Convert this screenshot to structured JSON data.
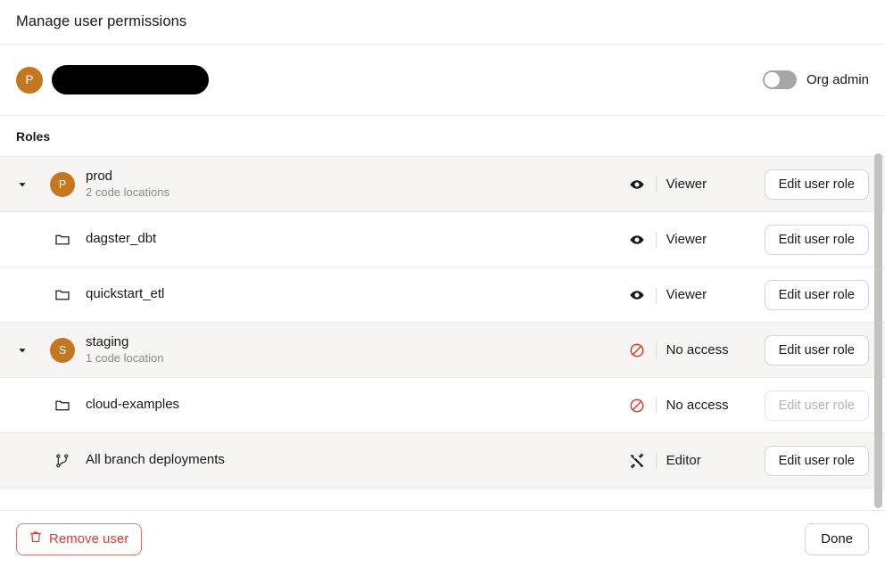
{
  "header": {
    "title": "Manage user permissions"
  },
  "user": {
    "avatar_initial": "P",
    "avatar_color": "#c3771f",
    "name_redacted": true,
    "org_admin_label": "Org admin",
    "org_admin_enabled": false
  },
  "roles_section": {
    "label": "Roles",
    "rows": [
      {
        "type": "deployment",
        "icon": "avatar-initial",
        "avatar_initial": "P",
        "expanded": true,
        "title": "prod",
        "subtitle": "2 code locations",
        "permission_icon": "eye-icon",
        "permission": "Viewer",
        "edit_label": "Edit user role",
        "edit_disabled": false,
        "shaded": true
      },
      {
        "type": "code-location",
        "icon": "folder-icon",
        "expanded": false,
        "title": "dagster_dbt",
        "subtitle": "",
        "permission_icon": "eye-icon",
        "permission": "Viewer",
        "edit_label": "Edit user role",
        "edit_disabled": false,
        "shaded": false
      },
      {
        "type": "code-location",
        "icon": "folder-icon",
        "expanded": false,
        "title": "quickstart_etl",
        "subtitle": "",
        "permission_icon": "eye-icon",
        "permission": "Viewer",
        "edit_label": "Edit user role",
        "edit_disabled": false,
        "shaded": false
      },
      {
        "type": "deployment",
        "icon": "avatar-initial",
        "avatar_initial": "S",
        "expanded": true,
        "title": "staging",
        "subtitle": "1 code location",
        "permission_icon": "no-access-icon",
        "permission": "No access",
        "edit_label": "Edit user role",
        "edit_disabled": false,
        "shaded": true
      },
      {
        "type": "code-location",
        "icon": "folder-icon",
        "expanded": false,
        "title": "cloud-examples",
        "subtitle": "",
        "permission_icon": "no-access-icon",
        "permission": "No access",
        "edit_label": "Edit user role",
        "edit_disabled": true,
        "shaded": false
      },
      {
        "type": "branch-deployments",
        "icon": "git-branch-icon",
        "expanded": false,
        "title": "All branch deployments",
        "subtitle": "",
        "permission_icon": "tools-icon",
        "permission": "Editor",
        "edit_label": "Edit user role",
        "edit_disabled": false,
        "shaded": true
      }
    ]
  },
  "footer": {
    "remove_label": "Remove user",
    "done_label": "Done"
  },
  "colors": {
    "avatar_orange": "#c3771f",
    "danger_red": "#e03a2f",
    "row_shaded": "#f6f5f3",
    "border": "#ebe9e6"
  }
}
